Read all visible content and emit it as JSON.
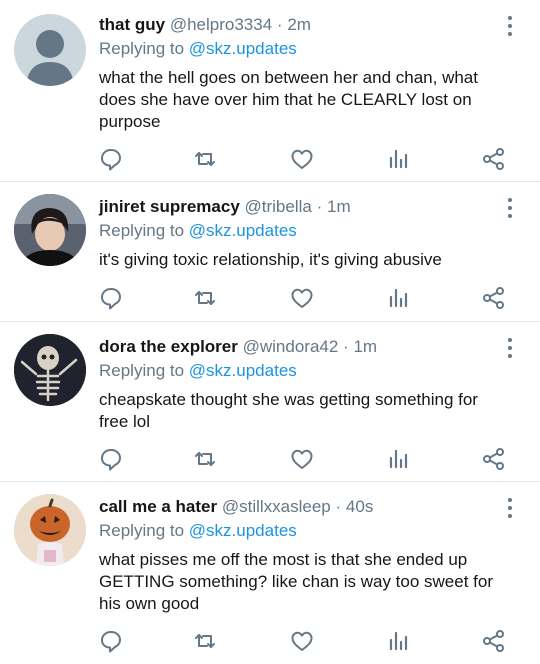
{
  "tweets": [
    {
      "name": "that guy",
      "handle": "@helpro3334",
      "sep": "·",
      "time": "2m",
      "replying_prefix": "Replying to",
      "replying_to": "@skz.updates",
      "text": "what the hell goes on between her and chan, what does she have over him that he CLEARLY lost on purpose",
      "avatar": "default-avatar"
    },
    {
      "name": "jiniret supremacy",
      "handle": "@tribella",
      "sep": "·",
      "time": "1m",
      "replying_prefix": "Replying to",
      "replying_to": "@skz.updates",
      "text": "it's giving toxic relationship, it's giving abusive",
      "avatar": "photo-avatar"
    },
    {
      "name": "dora the explorer",
      "handle": "@windora42",
      "sep": "·",
      "time": "1m",
      "replying_prefix": "Replying to",
      "replying_to": "@skz.updates",
      "text": "cheapskate thought she was getting something for free lol",
      "avatar": "skeleton-avatar"
    },
    {
      "name": "call me a hater",
      "handle": "@stillxxasleep",
      "sep": "·",
      "time": "40s",
      "replying_prefix": "Replying to",
      "replying_to": "@skz.updates",
      "text": "what pisses me off the most is that she ended up GETTING something? like chan is way too sweet for his own good",
      "avatar": "pumpkin-avatar"
    }
  ],
  "icons": [
    "reply-icon",
    "retweet-icon",
    "like-icon",
    "analytics-icon",
    "share-icon",
    "more-icon"
  ],
  "colors": {
    "icon": "#657786",
    "mention": "#1b95e0",
    "divider": "#e1e8ed"
  }
}
